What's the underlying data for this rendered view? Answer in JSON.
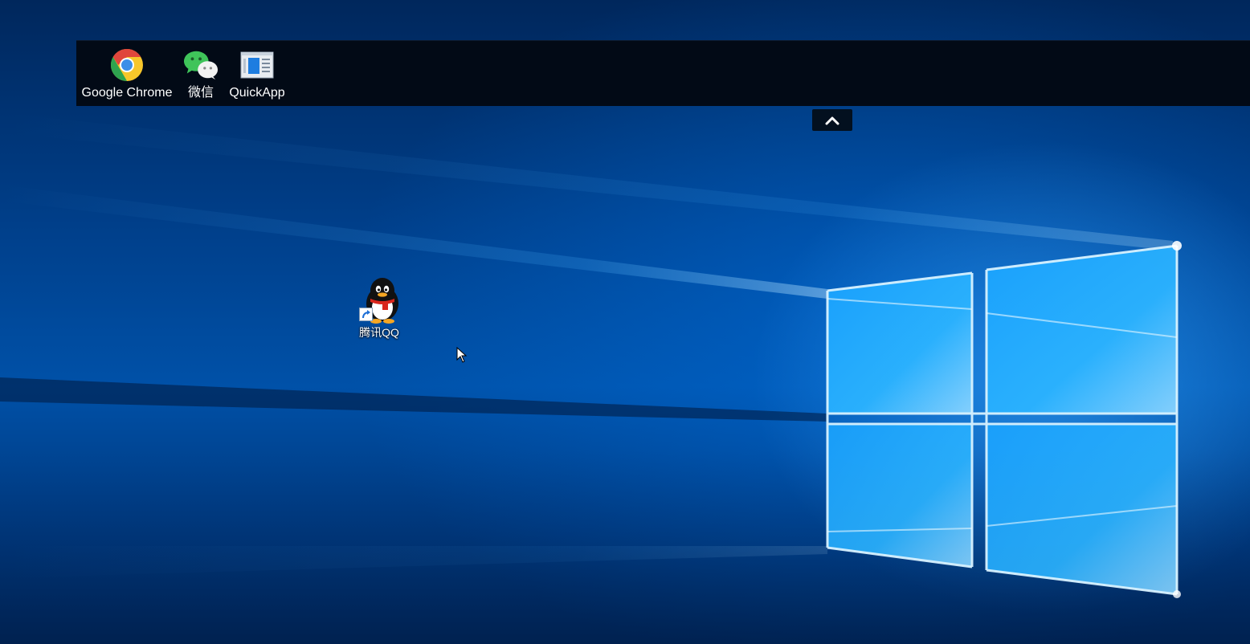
{
  "launcher": {
    "items": [
      {
        "label": "Google Chrome",
        "icon": "chrome-icon"
      },
      {
        "label": "微信",
        "icon": "wechat-icon"
      },
      {
        "label": "QuickApp",
        "icon": "quickapp-icon"
      }
    ],
    "collapse_icon": "chevron-up-icon"
  },
  "desktop": {
    "icons": [
      {
        "label": "腾讯QQ",
        "icon": "qq-penguin-icon",
        "shortcut": true
      }
    ]
  },
  "colors": {
    "launcher_bg": "#020a16",
    "wallpaper_blue": "#0051a8",
    "window_light": "#3ab4ff"
  }
}
